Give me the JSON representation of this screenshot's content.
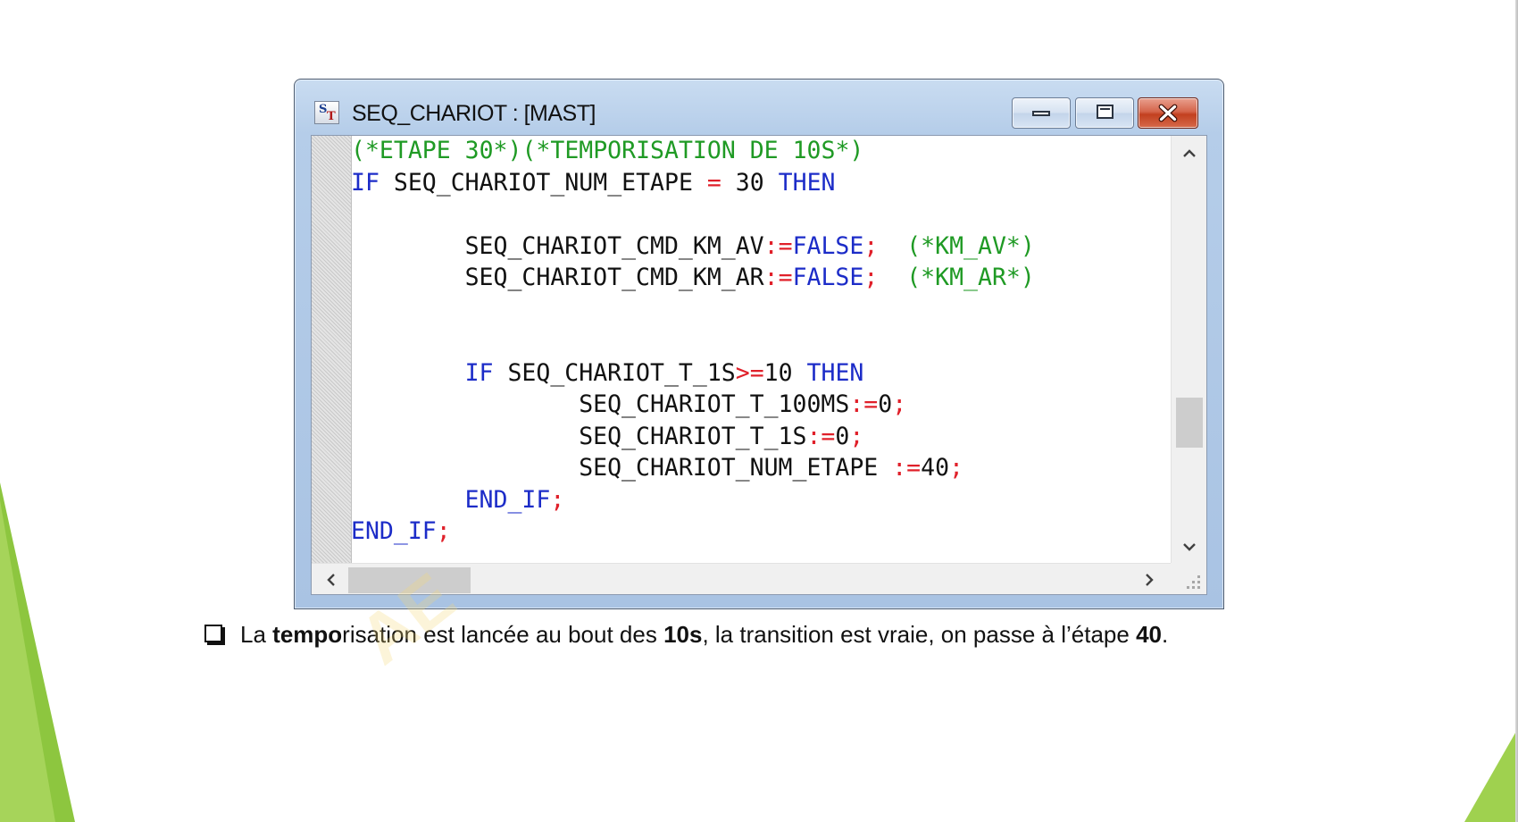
{
  "window": {
    "title": "SEQ_CHARIOT : [MAST]",
    "app_icon": "structured-text-icon",
    "controls": {
      "minimize_icon": "minimize-icon",
      "maximize_icon": "maximize-icon",
      "close_icon": "close-icon"
    }
  },
  "editor": {
    "lines": [
      {
        "indent": 0,
        "tokens": [
          {
            "t": "(*ETAPE 30*)",
            "k": "comment"
          },
          {
            "t": "(*TEMPORISATION DE 10S*)",
            "k": "comment"
          }
        ]
      },
      {
        "indent": 0,
        "tokens": [
          {
            "t": "IF",
            "k": "keyword"
          },
          {
            "t": " SEQ_CHARIOT_NUM_ETAPE ",
            "k": "ident"
          },
          {
            "t": "=",
            "k": "op"
          },
          {
            "t": " 30 ",
            "k": "number"
          },
          {
            "t": "THEN",
            "k": "keyword"
          }
        ]
      },
      {
        "indent": 0,
        "tokens": []
      },
      {
        "indent": 8,
        "tokens": [
          {
            "t": "SEQ_CHARIOT_CMD_KM_AV",
            "k": "ident"
          },
          {
            "t": ":=",
            "k": "op"
          },
          {
            "t": "FALSE",
            "k": "keyword"
          },
          {
            "t": ";",
            "k": "op"
          },
          {
            "t": "  (*KM_AV*)",
            "k": "comment"
          }
        ]
      },
      {
        "indent": 8,
        "tokens": [
          {
            "t": "SEQ_CHARIOT_CMD_KM_AR",
            "k": "ident"
          },
          {
            "t": ":=",
            "k": "op"
          },
          {
            "t": "FALSE",
            "k": "keyword"
          },
          {
            "t": ";",
            "k": "op"
          },
          {
            "t": "  (*KM_AR*)",
            "k": "comment"
          }
        ]
      },
      {
        "indent": 0,
        "tokens": []
      },
      {
        "indent": 0,
        "tokens": []
      },
      {
        "indent": 8,
        "tokens": [
          {
            "t": "IF",
            "k": "keyword"
          },
          {
            "t": " SEQ_CHARIOT_T_1S",
            "k": "ident"
          },
          {
            "t": ">=",
            "k": "op"
          },
          {
            "t": "10 ",
            "k": "number"
          },
          {
            "t": "THEN",
            "k": "keyword"
          }
        ]
      },
      {
        "indent": 16,
        "tokens": [
          {
            "t": "SEQ_CHARIOT_T_100MS",
            "k": "ident"
          },
          {
            "t": ":=",
            "k": "op"
          },
          {
            "t": "0",
            "k": "number"
          },
          {
            "t": ";",
            "k": "op"
          }
        ]
      },
      {
        "indent": 16,
        "tokens": [
          {
            "t": "SEQ_CHARIOT_T_1S",
            "k": "ident"
          },
          {
            "t": ":=",
            "k": "op"
          },
          {
            "t": "0",
            "k": "number"
          },
          {
            "t": ";",
            "k": "op"
          }
        ]
      },
      {
        "indent": 16,
        "tokens": [
          {
            "t": "SEQ_CHARIOT_NUM_ETAPE ",
            "k": "ident"
          },
          {
            "t": ":=",
            "k": "op"
          },
          {
            "t": "40",
            "k": "number"
          },
          {
            "t": ";",
            "k": "op"
          }
        ]
      },
      {
        "indent": 8,
        "tokens": [
          {
            "t": "END_IF",
            "k": "keyword"
          },
          {
            "t": ";",
            "k": "op"
          }
        ]
      },
      {
        "indent": 0,
        "tokens": [
          {
            "t": "END_IF",
            "k": "keyword"
          },
          {
            "t": ";",
            "k": "op"
          }
        ]
      }
    ],
    "vertical_scroll_fraction": 0.74,
    "horizontal_scroll_fraction": 0.0,
    "scroll_icons": {
      "up": "chevron-up-icon",
      "down": "chevron-down-icon",
      "left": "chevron-left-icon",
      "right": "chevron-right-icon"
    }
  },
  "caption": {
    "bullet_icon": "checkbox-bullet-icon",
    "segments": [
      {
        "text": "La ",
        "bold": false
      },
      {
        "text": "tempo",
        "bold": true
      },
      {
        "text": "risation est lancée au bout des ",
        "bold": false
      },
      {
        "text": "10s",
        "bold": true
      },
      {
        "text": ", la transition est vraie, on passe à l’étape ",
        "bold": false
      },
      {
        "text": "40",
        "bold": true
      },
      {
        "text": ".",
        "bold": false
      }
    ]
  },
  "watermark": {
    "text": "AE"
  },
  "colors": {
    "comment": "#1f9a24",
    "keyword": "#1c2cc8",
    "operator": "#e0202a",
    "identifier": "#111111",
    "slide_accent_green": "#8dc63f",
    "close_button": "#c2401f"
  }
}
